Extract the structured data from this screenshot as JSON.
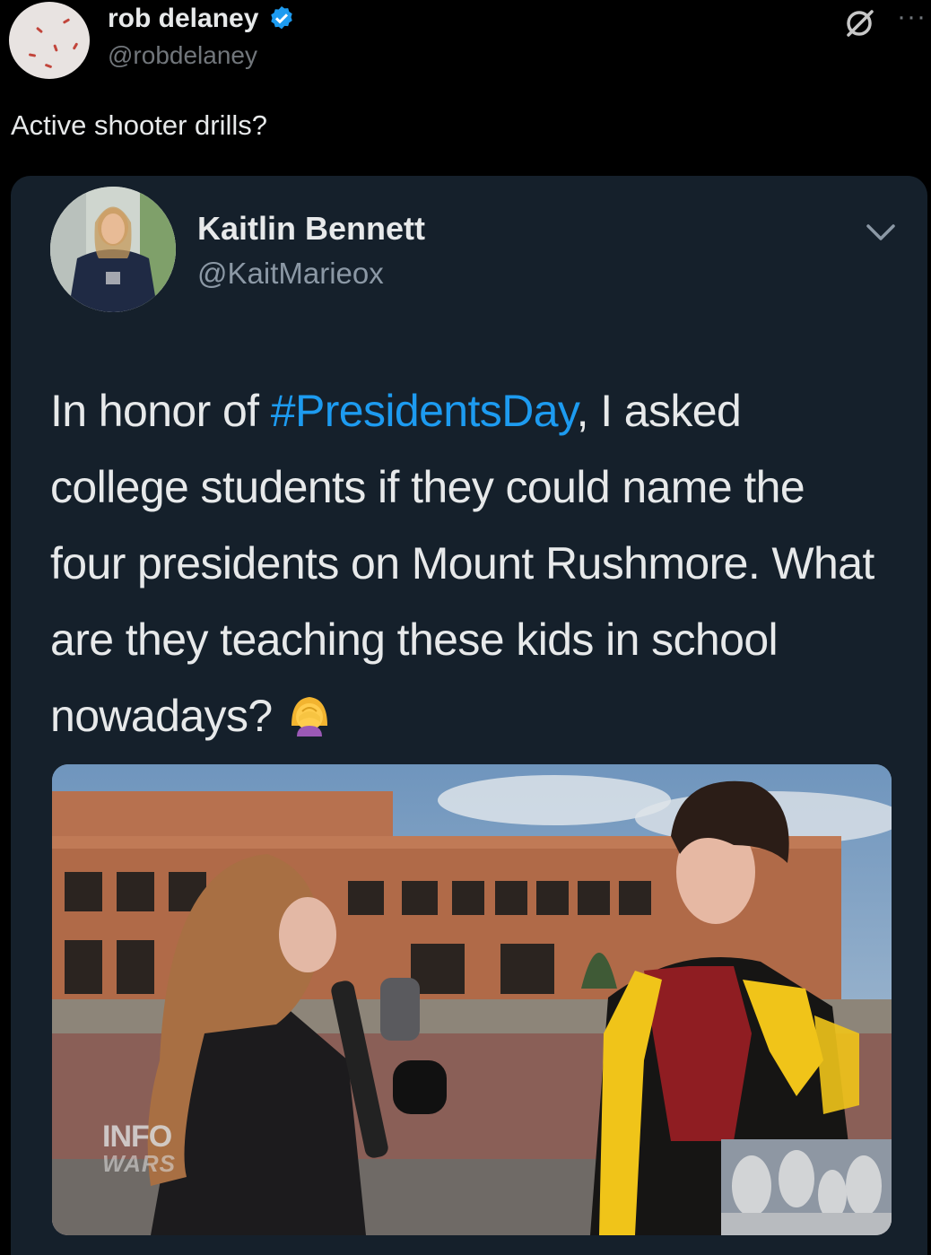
{
  "outer_tweet": {
    "author_name": "rob delaney",
    "author_handle": "@robdelaney",
    "text": "Active shooter drills?"
  },
  "quoted_tweet": {
    "author_name": "Kaitlin Bennett",
    "author_handle": "@KaitMarieox",
    "text_before": "In honor of ",
    "hashtag": "#PresidentsDay",
    "text_after": ", I asked college students if they could name the four presidents on Mount Rushmore. What are they teaching these kids in school nowadays? "
  },
  "media": {
    "logo_line1": "INFO",
    "logo_line2": "WARS"
  },
  "colors": {
    "background": "#000000",
    "card": "#15202b",
    "hashtag": "#1d9bf0",
    "verified": "#1d9bf0"
  },
  "icons": [
    "verified-badge-icon",
    "swipe-icon",
    "more-icon",
    "chevron-down-icon",
    "facepalm-emoji-icon"
  ]
}
